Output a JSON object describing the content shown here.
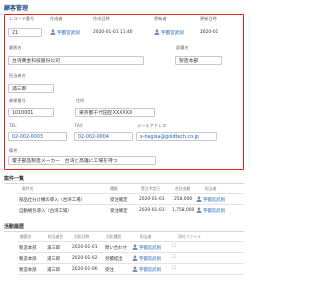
{
  "title": "顧客管理",
  "record": {
    "fields": [
      {
        "label": "レコード番号",
        "value": "21"
      },
      {
        "label": "作成者",
        "value": "宇都宮武則"
      },
      {
        "label": "作成日時",
        "value": "2020-01-01 11:40"
      },
      {
        "label": "更新者",
        "value": "宇都宮武則"
      },
      {
        "label": "更新日時",
        "value": "2020-01"
      },
      {
        "label": "顧客名",
        "value": "台湾黄金科技股份公司"
      },
      {
        "label": "部署名",
        "value": "製造本部"
      },
      {
        "label": "担当者名",
        "value": "浦三郎"
      },
      {
        "label": "郵便番号",
        "value": "1010001"
      },
      {
        "label": "住所",
        "value": "東京都千代田区XXXXXX"
      },
      {
        "label": "TEL",
        "value": "02-002-0003"
      },
      {
        "label": "FAX",
        "value": "02-002-0004"
      },
      {
        "label": "メールアドレス",
        "value": "x-nagisa@goldtech.co.jp"
      },
      {
        "label": "備考",
        "value": "電子部品製造メーカー　台湾と高雄に工場を持つ"
      }
    ]
  },
  "deals": {
    "title": "案件一覧",
    "headers": [
      "案件名",
      "種類",
      "受注予定日",
      "合計金額",
      "担当者"
    ],
    "rows": [
      {
        "name": "部品仕分け機の導入（台湾工場）",
        "type": "受注確定",
        "date": "2020-01-03",
        "amount": "258,000",
        "owner": "宇都宮武則"
      },
      {
        "name": "自動梱包導入（台湾工場）",
        "type": "受注確定",
        "date": "2020-01-03",
        "amount": "1,758,000",
        "owner": "宇都宮武則"
      }
    ]
  },
  "activities": {
    "title": "活動履歴",
    "headers": [
      "顧客名",
      "担当者名",
      "対応日時",
      "対応種別",
      "担当者",
      "添付ファイル"
    ],
    "rows": [
      {
        "customer": "製造本部",
        "contact": "浦三郎",
        "date": "2020-01-01",
        "kind": "問い合わせ",
        "owner": "宇都宮武則"
      },
      {
        "customer": "製造本部",
        "contact": "浦三郎",
        "date": "2020-01-02",
        "kind": "見積提出",
        "owner": "宇都宮武則"
      },
      {
        "customer": "製造本部",
        "contact": "浦三郎",
        "date": "2020-01-06",
        "kind": "受注",
        "owner": "宇都宮武則"
      }
    ]
  },
  "colors": {
    "highlight_frame": "#e52a1f",
    "title": "#2d4d8a",
    "link": "#1a5fb4"
  },
  "icons": {
    "user": "user-icon",
    "attachment": "checkbox-icon"
  }
}
